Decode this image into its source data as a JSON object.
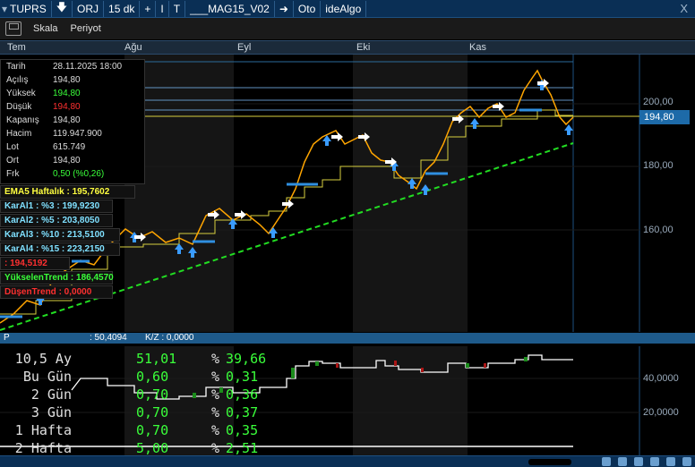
{
  "toolbar": {
    "symbol": "TUPRS",
    "download_icon": "download-icon",
    "orj": "ORJ",
    "period": "15 dk",
    "plus": "+",
    "cursor_icon": "cursor-icon",
    "text_tool": "T",
    "system": "___MAG15_V02",
    "arrow_icon": "arrow-right-icon",
    "auto": "Oto",
    "algo": "ideAlgo",
    "close": "X"
  },
  "toolbar2": {
    "save_icon": "save-icon",
    "scale": "Skala",
    "period": "Periyot"
  },
  "date_header": {
    "labels": [
      "Tem",
      "Ağu",
      "Eyl",
      "Eki",
      "Kas"
    ]
  },
  "info": {
    "rows": [
      {
        "k": "Tarih",
        "v": "28.11.2025 18:00"
      },
      {
        "k": "Açılış",
        "v": "194,80"
      },
      {
        "k": "Yüksek",
        "v": "194,80"
      },
      {
        "k": "Düşük",
        "v": "194,80"
      },
      {
        "k": "Kapanış",
        "v": "194,80"
      },
      {
        "k": "Hacim",
        "v": "119.947.900"
      },
      {
        "k": "Lot",
        "v": "615.749"
      },
      {
        "k": "Ort",
        "v": "194,80"
      },
      {
        "k": "Frk",
        "v": "0,50 (%0,26)"
      }
    ],
    "colors": {
      "Yüksek": "#3aff3a",
      "Düşük": "#ff3030",
      "Frk": "#3aff3a"
    }
  },
  "indicators": [
    {
      "text": "EMA5 Haftalık :  195,7602",
      "color": "#ffff40"
    },
    {
      "text": "KarAl1 : %3 :  199,9230",
      "color": "#7fe0ff"
    },
    {
      "text": "KarAl2 : %5 :  203,8050",
      "color": "#7fe0ff"
    },
    {
      "text": "KarAl3 : %10 :  213,5100",
      "color": "#7fe0ff"
    },
    {
      "text": "KarAl4 : %15 :  223,2150",
      "color": "#7fe0ff"
    },
    {
      "text": " :  194,5192",
      "color": "#ff3030"
    },
    {
      "text": "YükselenTrend :  186,4570",
      "color": "#3aff3a"
    },
    {
      "text": "DüşenTrend :  0,0000",
      "color": "#ff3030"
    }
  ],
  "price_axis": {
    "labels": [
      "200,00",
      "180,00",
      "160,00"
    ],
    "current": "194,80"
  },
  "sub_header": {
    "p": "P",
    "value": ": 50,4094",
    "kz": "K/Z : 0,0000"
  },
  "sub_axis": {
    "labels": [
      "40,0000",
      "20,0000"
    ]
  },
  "table": [
    {
      "label": "10,5 Ay",
      "a": "51,01",
      "pct": "%",
      "b": "39,66"
    },
    {
      "label": "Bu Gün",
      "a": "0,60",
      "pct": "%",
      "b": "0,31"
    },
    {
      "label": "2 Gün",
      "a": "0,70",
      "pct": "%",
      "b": "0,36"
    },
    {
      "label": "3 Gün",
      "a": "0,70",
      "pct": "%",
      "b": "0,37"
    },
    {
      "label": "1 Hafta",
      "a": "0,70",
      "pct": "%",
      "b": "0,35"
    },
    {
      "label": "2 Hafta",
      "a": "5,00",
      "pct": "%",
      "b": "2,51"
    }
  ],
  "colors": {
    "accent": "#0a2f55",
    "up": "#3aff3a",
    "down": "#ff3030",
    "trend": "#22dd22"
  }
}
